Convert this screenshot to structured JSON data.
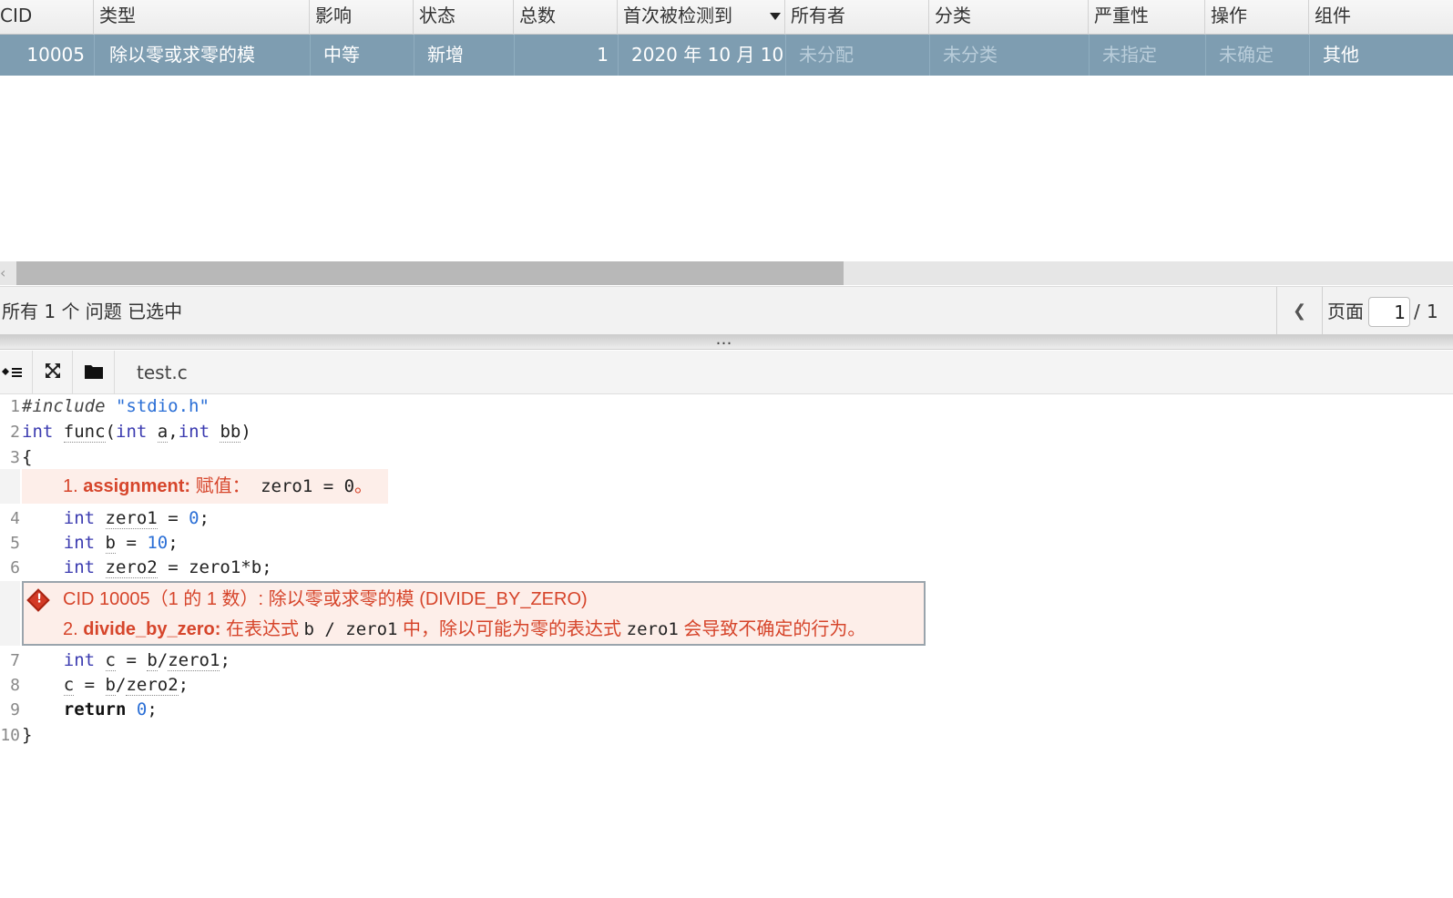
{
  "table": {
    "columns": [
      "CID",
      "类型",
      "影响",
      "状态",
      "总数",
      "首次被检测到",
      "所有者",
      "分类",
      "严重性",
      "操作",
      "组件"
    ],
    "row": {
      "cid": "10005",
      "type": "除以零或求零的模",
      "impact": "中等",
      "status": "新增",
      "count": "1",
      "first_detected": "2020 年 10 月 10",
      "owner": "未分配",
      "classification": "未分类",
      "severity": "未指定",
      "action": "未确定",
      "component": "其他"
    }
  },
  "status_bar": {
    "selection_text": "所有 1 个 问题 已选中",
    "page_label": "页面",
    "page_value": "1",
    "page_sep": "/",
    "page_total": "1"
  },
  "source": {
    "file_tab": "test.c",
    "lines": [
      {
        "no": "1"
      },
      {
        "no": "2"
      },
      {
        "no": "3"
      },
      {
        "no": "4"
      },
      {
        "no": "5"
      },
      {
        "no": "6"
      },
      {
        "no": "7"
      },
      {
        "no": "8"
      },
      {
        "no": "9"
      },
      {
        "no": "10"
      }
    ],
    "events": {
      "e1_prefix": "1. ",
      "e1_tag": "assignment:",
      "e1_text": " 赋值：",
      "e1_code": " zero1 = 0",
      "e1_end": "。",
      "main_title": "CID 10005（1 的 1 数）: 除以零或求零的模 (DIVIDE_BY_ZERO)",
      "e2_prefix": "2. ",
      "e2_tag": "divide_by_zero:",
      "e2_text1": " 在表达式 ",
      "e2_code1": "b / zero1",
      "e2_text2": " 中，除以可能为零的表达式 ",
      "e2_code2": "zero1",
      "e2_text3": " 会导致不确定的行为。"
    }
  }
}
